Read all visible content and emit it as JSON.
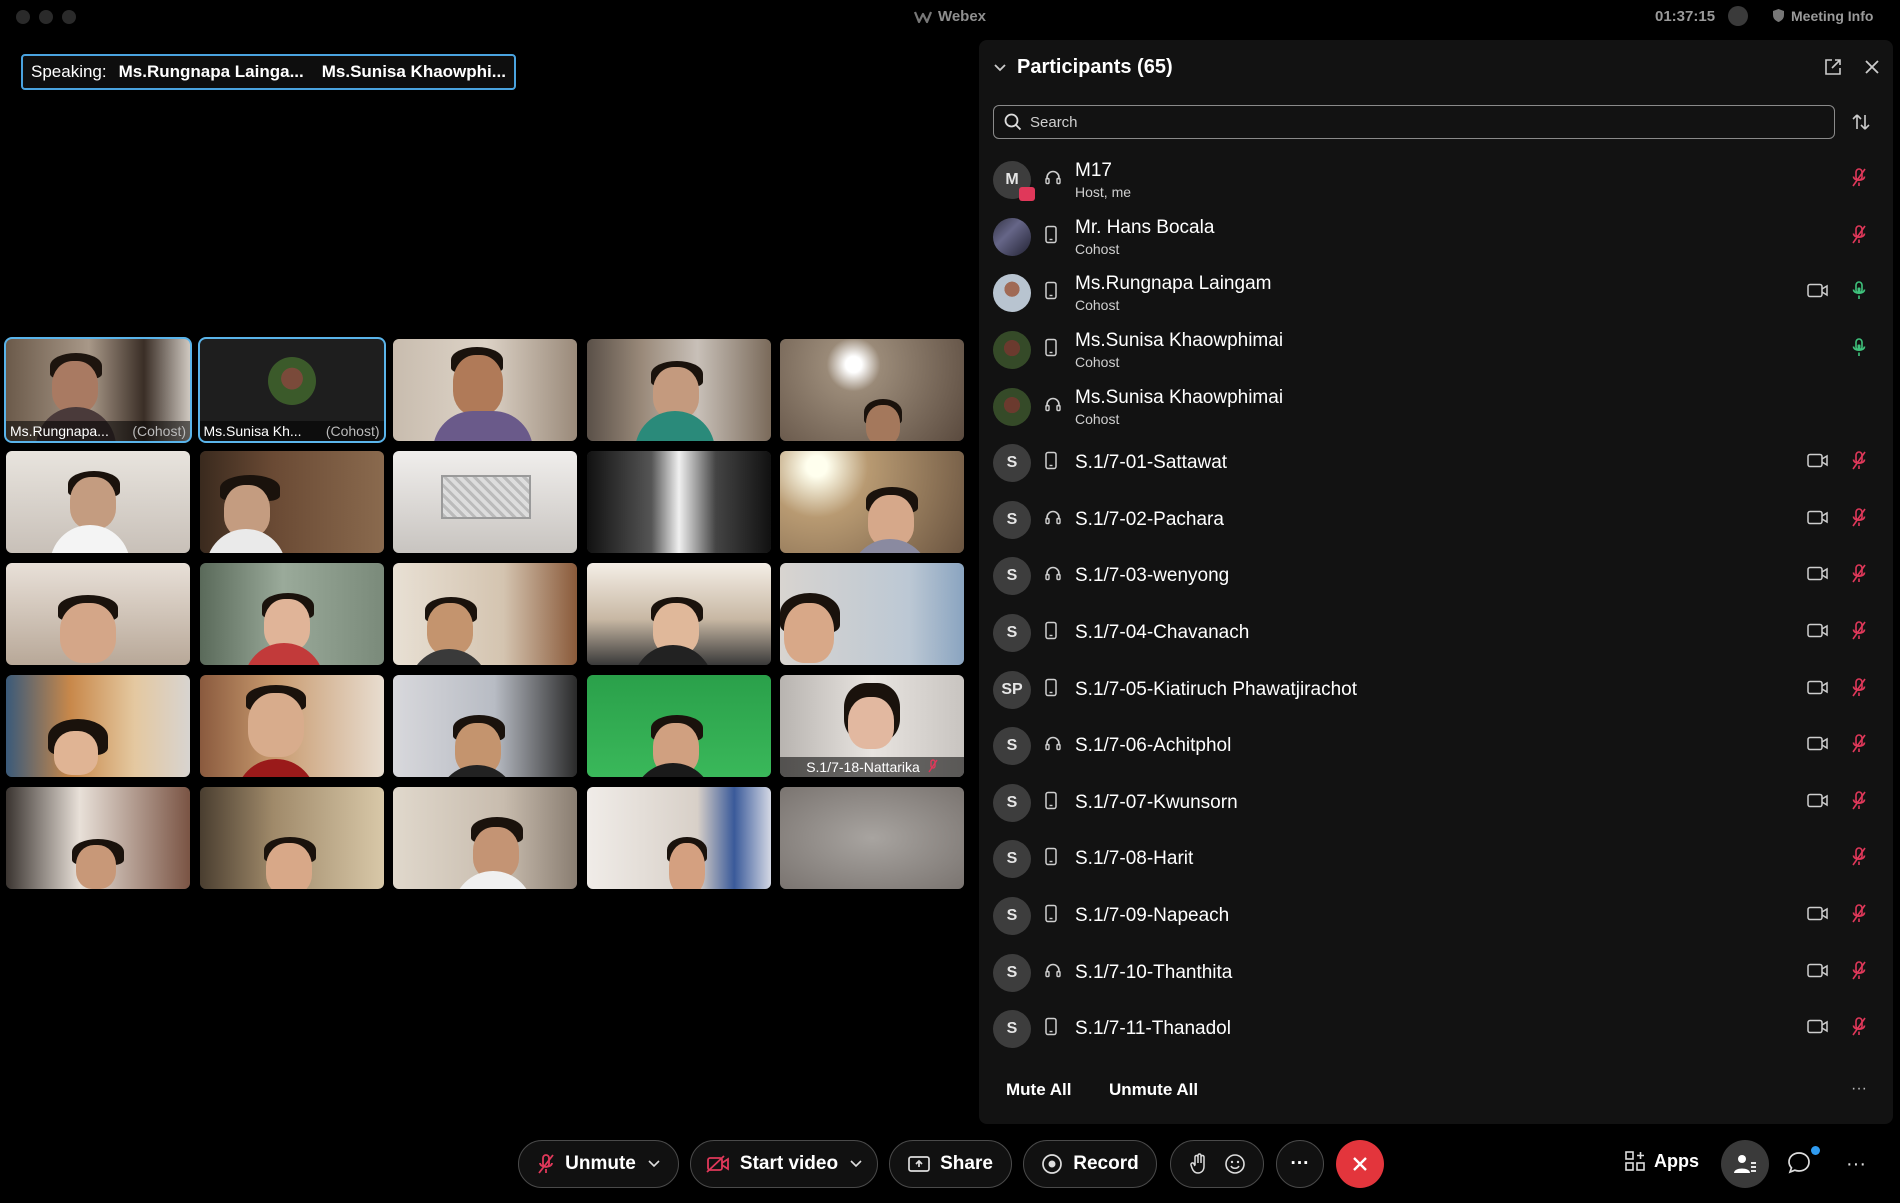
{
  "window": {
    "title": "Webex",
    "clock": "01:37:15",
    "meeting_info_label": "Meeting Info"
  },
  "speaking": {
    "label": "Speaking:",
    "names": [
      "Ms.Rungnapa Lainga...",
      "Ms.Sunisa Khaowphi..."
    ]
  },
  "video_tiles": [
    {
      "caption": "Ms.Rungnapa...",
      "role": "(Cohost)",
      "active": true
    },
    {
      "caption": "Ms.Sunisa Kh...",
      "role": "(Cohost)",
      "active": true
    },
    {
      "caption": ""
    },
    {
      "caption": ""
    },
    {
      "caption": ""
    },
    {
      "caption": ""
    },
    {
      "caption": ""
    },
    {
      "caption": ""
    },
    {
      "caption": ""
    },
    {
      "caption": ""
    },
    {
      "caption": ""
    },
    {
      "caption": ""
    },
    {
      "caption": ""
    },
    {
      "caption": ""
    },
    {
      "caption": ""
    },
    {
      "caption": ""
    },
    {
      "caption": ""
    },
    {
      "caption": ""
    },
    {
      "caption": ""
    },
    {
      "caption": "S.1/7-18-Nattarika",
      "muted": true
    },
    {
      "caption": ""
    },
    {
      "caption": ""
    },
    {
      "caption": ""
    },
    {
      "caption": ""
    },
    {
      "caption": ""
    }
  ],
  "participants": {
    "header": "Participants (65)",
    "search_placeholder": "Search",
    "list": [
      {
        "initials": "M",
        "name": "M17",
        "role": "Host, me",
        "device": "headset-icon",
        "camera": false,
        "mic": "muted"
      },
      {
        "initials": "",
        "name": "Mr. Hans Bocala",
        "role": "Cohost",
        "device": "phone-icon",
        "camera": false,
        "mic": "muted"
      },
      {
        "initials": "",
        "name": "Ms.Rungnapa Laingam",
        "role": "Cohost",
        "device": "phone-icon",
        "camera": true,
        "mic": "on"
      },
      {
        "initials": "",
        "name": "Ms.Sunisa Khaowphimai",
        "role": "Cohost",
        "device": "phone-icon",
        "camera": false,
        "mic": "on"
      },
      {
        "initials": "",
        "name": "Ms.Sunisa Khaowphimai",
        "role": "Cohost",
        "device": "headset-icon",
        "camera": false,
        "mic": "none"
      },
      {
        "initials": "S",
        "name": "S.1/7-01-Sattawat",
        "role": "",
        "device": "phone-icon",
        "camera": true,
        "mic": "muted"
      },
      {
        "initials": "S",
        "name": "S.1/7-02-Pachara",
        "role": "",
        "device": "headset-icon",
        "camera": true,
        "mic": "muted"
      },
      {
        "initials": "S",
        "name": "S.1/7-03-wenyong",
        "role": "",
        "device": "headset-icon",
        "camera": true,
        "mic": "muted"
      },
      {
        "initials": "S",
        "name": "S.1/7-04-Chavanach",
        "role": "",
        "device": "phone-icon",
        "camera": true,
        "mic": "muted"
      },
      {
        "initials": "SP",
        "name": "S.1/7-05-Kiatiruch Phawatjirachot",
        "role": "",
        "device": "phone-icon",
        "camera": true,
        "mic": "muted"
      },
      {
        "initials": "S",
        "name": "S.1/7-06-Achitphol",
        "role": "",
        "device": "headset-icon",
        "camera": true,
        "mic": "muted"
      },
      {
        "initials": "S",
        "name": "S.1/7-07-Kwunsorn",
        "role": "",
        "device": "phone-icon",
        "camera": true,
        "mic": "muted"
      },
      {
        "initials": "S",
        "name": "S.1/7-08-Harit",
        "role": "",
        "device": "phone-icon",
        "camera": false,
        "mic": "muted"
      },
      {
        "initials": "S",
        "name": "S.1/7-09-Napeach",
        "role": "",
        "device": "phone-icon",
        "camera": true,
        "mic": "muted"
      },
      {
        "initials": "S",
        "name": "S.1/7-10-Thanthita",
        "role": "",
        "device": "headset-icon",
        "camera": true,
        "mic": "muted"
      },
      {
        "initials": "S",
        "name": "S.1/7-11-Thanadol",
        "role": "",
        "device": "phone-icon",
        "camera": true,
        "mic": "muted"
      }
    ],
    "mute_all": "Mute All",
    "unmute_all": "Unmute All",
    "more": "···"
  },
  "toolbar": {
    "unmute": "Unmute",
    "start_video": "Start video",
    "share": "Share",
    "record": "Record",
    "more": "···",
    "apps": "Apps",
    "overflow": "···"
  },
  "colors": {
    "accent": "#5ab4ea",
    "end_call": "#e3353c",
    "mic_muted": "#e0385a",
    "mic_on": "#3fc37c"
  }
}
